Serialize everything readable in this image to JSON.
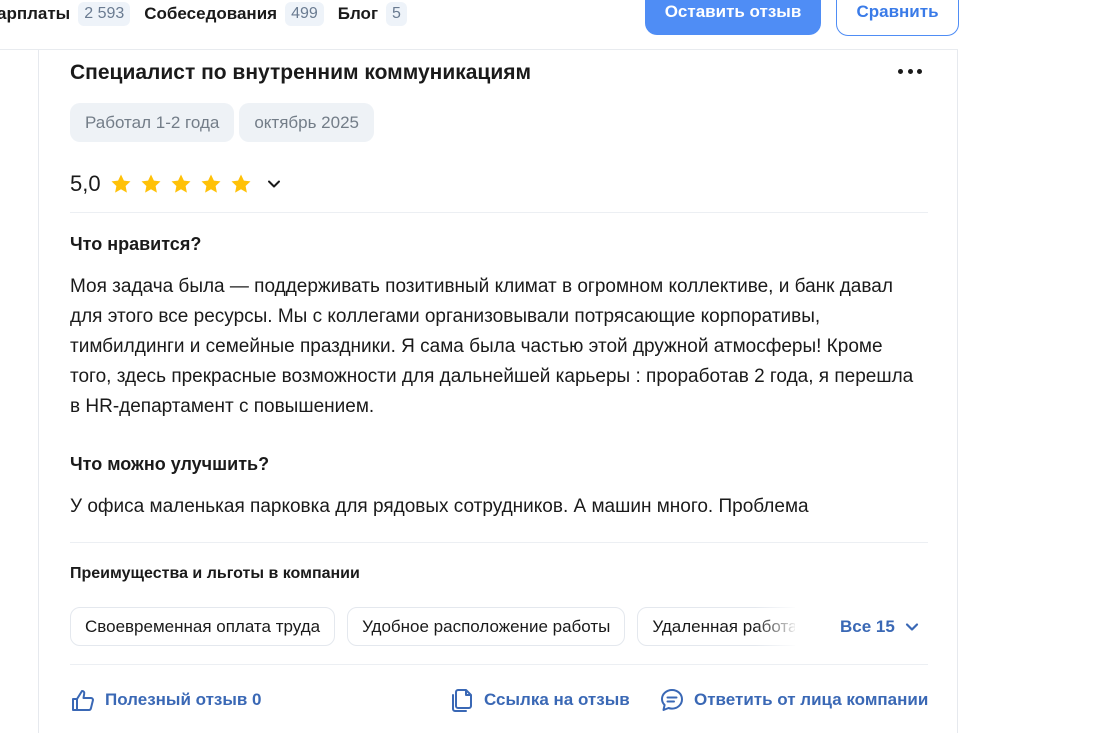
{
  "nav": {
    "tabs": [
      {
        "label": "арплаты",
        "count": "2 593"
      },
      {
        "label": "Собеседования",
        "count": "499"
      },
      {
        "label": "Блог",
        "count": "5"
      }
    ],
    "leave_review_label": "Оставить отзыв",
    "compare_label": "Сравнить"
  },
  "review": {
    "title": "Специалист по внутренним коммуникациям",
    "tags": [
      "Работал 1-2 года",
      "октябрь 2025"
    ],
    "rating": "5,0",
    "stars": 5,
    "likes_title": "Что нравится?",
    "likes_text": "Моя задача была — поддерживать позитивный климат в огромном коллективе, и банк давал для этого все ресурсы. Мы с коллегами организовывали потрясающие корпоративы, тимбилдинги и семейные праздники. Я сама была частью этой дружной атмосферы! Кроме того, здесь прекрасные возможности для дальнейшей карьеры : проработав 2 года, я перешла в HR-департамент с повышением.",
    "improve_title": "Что можно улучшить?",
    "improve_text": "У офиса маленькая парковка для рядовых сотрудников. А машин много. Проблема",
    "benefits_title": "Преимущества и льготы в компании",
    "benefits": [
      "Своевременная оплата труда",
      "Удобное расположение работы",
      "Удаленная работа"
    ],
    "show_all_label": "Все 15",
    "helpful_label": "Полезный отзыв 0",
    "link_label": "Ссылка на отзыв",
    "reply_label": "Ответить от лица компании"
  },
  "colors": {
    "accent": "#4f8df5",
    "link": "#3a68b5",
    "star": "#ffc107",
    "chip_bg": "#eef2f6"
  },
  "icons": {
    "more": "more-horizontal-icon",
    "star": "star-icon",
    "chevron": "chevron-down-icon",
    "like": "thumbs-up-icon",
    "link": "copy-link-icon",
    "reply": "chat-bubble-icon"
  }
}
